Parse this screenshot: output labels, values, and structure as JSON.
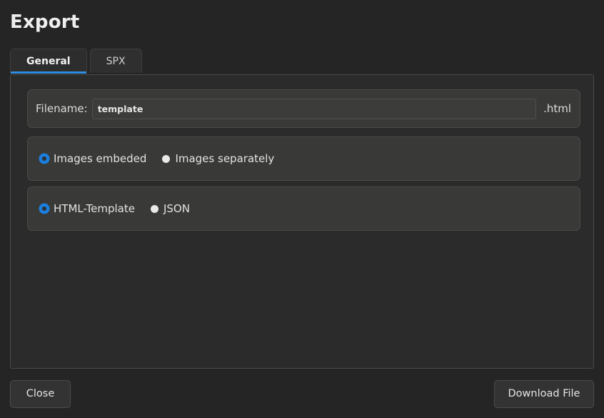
{
  "dialog": {
    "title": "Export"
  },
  "tabs": [
    {
      "label": "General",
      "active": true
    },
    {
      "label": "SPX",
      "active": false
    }
  ],
  "filename_group": {
    "label": "Filename:",
    "value": "template",
    "placeholder": "",
    "extension": ".html"
  },
  "images_group": {
    "options": [
      {
        "label": "Images embeded",
        "selected": true
      },
      {
        "label": "Images separately",
        "selected": false
      }
    ]
  },
  "format_group": {
    "options": [
      {
        "label": "HTML-Template",
        "selected": true
      },
      {
        "label": "JSON",
        "selected": false
      }
    ]
  },
  "footer": {
    "close_label": "Close",
    "download_label": "Download File"
  },
  "colors": {
    "background": "#252525",
    "panel": "#2b2b2b",
    "group": "#393937",
    "accent": "#2e8fe0",
    "radio_selected": "#1b7fe0",
    "text": "#e3e3e3",
    "border": "#4a4a48"
  }
}
